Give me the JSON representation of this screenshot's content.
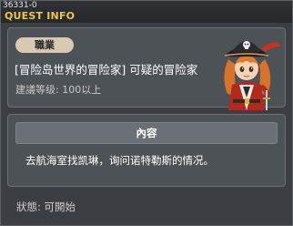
{
  "window": {
    "quest_id": "36331-0",
    "title": "QUEST INFO"
  },
  "quest": {
    "job_badge": "職業",
    "name": "[冒险岛世界的冒险家] 可疑的冒险家",
    "level": "建議等级: 100以上"
  },
  "content": {
    "header": "內容",
    "text": "去航海室找凯琳，询问诺特勒斯的情况。"
  },
  "status": {
    "text": "狀態: 可開始"
  },
  "npc": {
    "icon": "pirate-npc-icon"
  },
  "colors": {
    "title": "#e8c84a",
    "badge": "#d7c9b2",
    "panel": "#4d5256",
    "window": "#3b3f43"
  }
}
